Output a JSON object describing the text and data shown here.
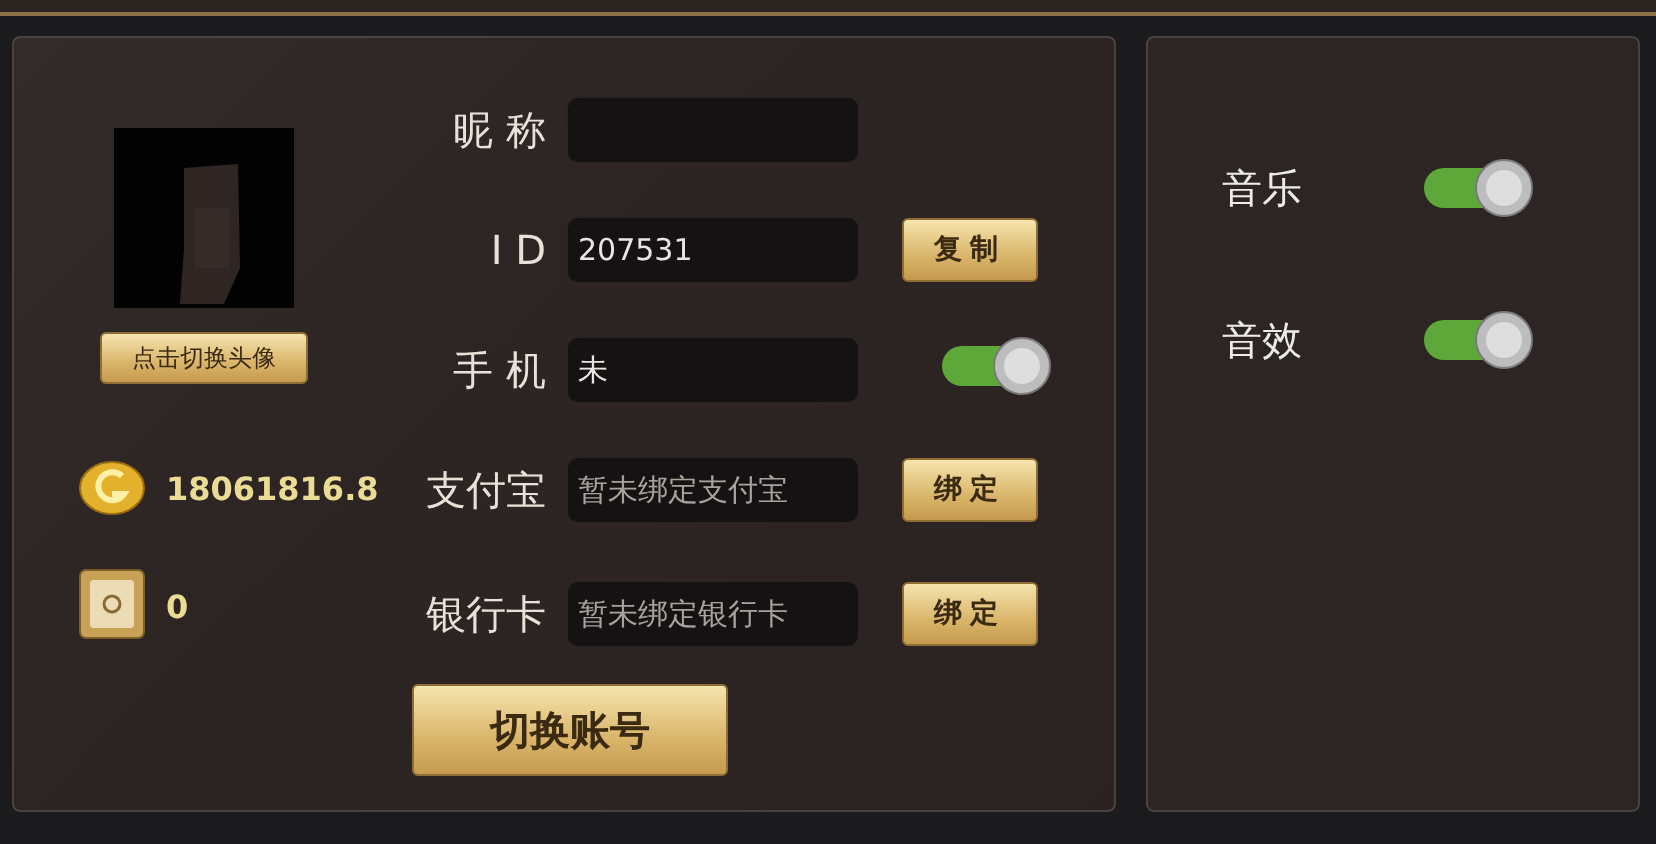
{
  "profile": {
    "change_avatar_button": "点击切换头像",
    "balances": [
      {
        "kind": "coin",
        "amount": "18061816.8"
      },
      {
        "kind": "safe",
        "amount": "0"
      }
    ]
  },
  "form": {
    "rows": [
      {
        "kind": "field",
        "label": "昵 称"
      },
      {
        "kind": "field-button",
        "label": "I D",
        "value": "207531",
        "button": "复制"
      },
      {
        "kind": "field-toggle",
        "label": "手 机",
        "value": "未",
        "on": true
      },
      {
        "kind": "field-button",
        "label": "支付宝",
        "placeholder": "暂未绑定支付宝",
        "button": "绑定"
      },
      {
        "kind": "field-button",
        "label": "银行卡",
        "placeholder": "暂未绑定银行卡",
        "button": "绑定"
      }
    ],
    "switch_account_button": "切换账号"
  },
  "settings": [
    {
      "label": "音乐",
      "on": true
    },
    {
      "label": "音效",
      "on": true
    }
  ]
}
